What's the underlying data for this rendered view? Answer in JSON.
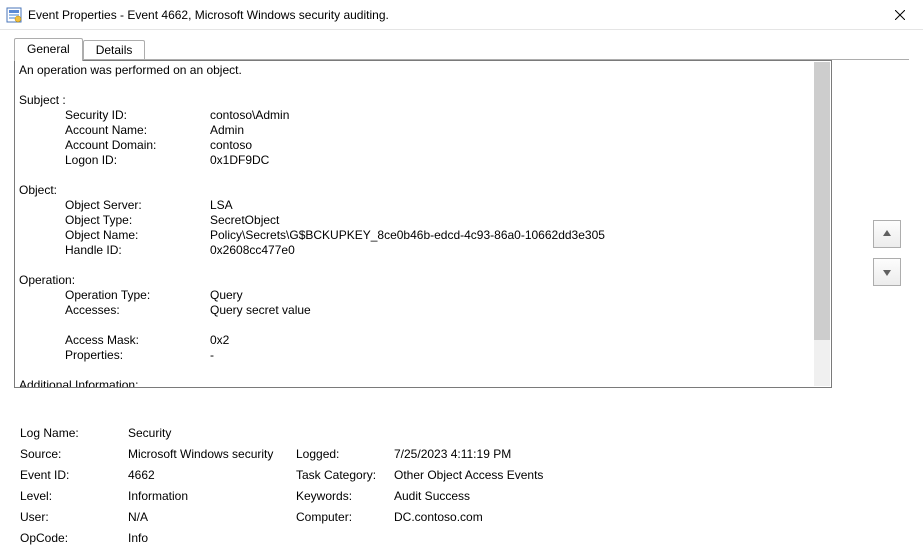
{
  "window": {
    "title": "Event Properties - Event 4662, Microsoft Windows security auditing."
  },
  "tabs": {
    "general": "General",
    "details": "Details"
  },
  "desc": {
    "heading": "An operation was performed on an object.",
    "subject_header": "Subject :",
    "security_id_label": "Security ID:",
    "security_id_value": "contoso\\Admin",
    "account_name_label": "Account Name:",
    "account_name_value": "Admin",
    "account_domain_label": "Account Domain:",
    "account_domain_value": "contoso",
    "logon_id_label": "Logon ID:",
    "logon_id_value": "0x1DF9DC",
    "object_header": "Object:",
    "object_server_label": "Object Server:",
    "object_server_value": "LSA",
    "object_type_label": "Object Type:",
    "object_type_value": "SecretObject",
    "object_name_label": "Object Name:",
    "object_name_value": "Policy\\Secrets\\G$BCKUPKEY_8ce0b46b-edcd-4c93-86a0-10662dd3e305",
    "handle_id_label": "Handle ID:",
    "handle_id_value": "0x2608cc477e0",
    "operation_header": "Operation:",
    "operation_type_label": "Operation Type:",
    "operation_type_value": "Query",
    "accesses_label": "Accesses:",
    "accesses_value": "Query secret value",
    "access_mask_label": "Access Mask:",
    "access_mask_value": "0x2",
    "properties_label": "Properties:",
    "properties_value": "-",
    "additional_header": "Additional Information:"
  },
  "summary": {
    "log_name_label": "Log Name:",
    "log_name_value": "Security",
    "source_label": "Source:",
    "source_value": "Microsoft Windows security",
    "logged_label": "Logged:",
    "logged_value": "7/25/2023 4:11:19 PM",
    "event_id_label": "Event ID:",
    "event_id_value": "4662",
    "task_category_label": "Task Category:",
    "task_category_value": "Other Object Access Events",
    "level_label": "Level:",
    "level_value": "Information",
    "keywords_label": "Keywords:",
    "keywords_value": "Audit Success",
    "user_label": "User:",
    "user_value": "N/A",
    "computer_label": "Computer:",
    "computer_value": "DC.contoso.com",
    "opcode_label": "OpCode:",
    "opcode_value": "Info"
  }
}
